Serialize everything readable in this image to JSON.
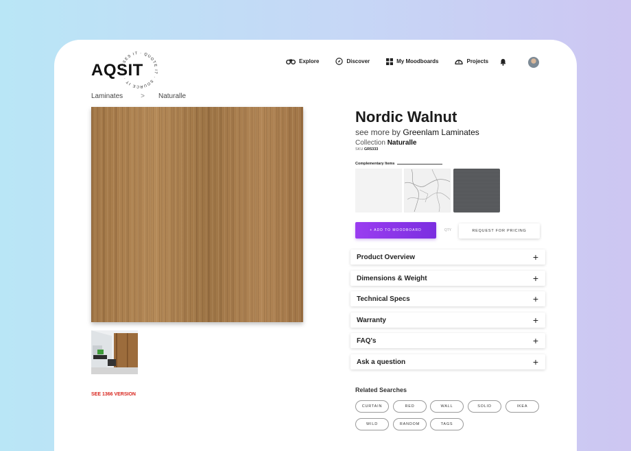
{
  "brand": {
    "logo_text": "AQSIT",
    "ring_text": "ASSES IT · QUOTE IT · SOURCE IT ·"
  },
  "nav": {
    "items": [
      {
        "label": "Explore",
        "icon": "binoculars-icon"
      },
      {
        "label": "Discover",
        "icon": "compass-icon"
      },
      {
        "label": "My Moodboards",
        "icon": "grid-icon"
      },
      {
        "label": "Projects",
        "icon": "helmet-icon"
      }
    ],
    "bell_icon": "bell-icon",
    "avatar_icon": "user-avatar"
  },
  "breadcrumb": {
    "items": [
      "Laminates",
      "Naturalle"
    ],
    "separator": ">"
  },
  "product": {
    "title": "Nordic Walnut",
    "by_prefix": "see more by ",
    "brand": "Greenlam Laminates",
    "collection_prefix": "Collection ",
    "collection": "Naturalle",
    "sku_prefix": "SKU ",
    "sku": "GR5333"
  },
  "complementary": {
    "title": "Complementary Items"
  },
  "actions": {
    "add_label": "+ ADD TO MOODBOARD",
    "qty_placeholder": "QTY",
    "pricing_label": "REQUEST FOR PRICING"
  },
  "accordion": [
    {
      "label": "Product Overview"
    },
    {
      "label": "Dimensions & Weight"
    },
    {
      "label": "Technical Specs"
    },
    {
      "label": "Warranty"
    },
    {
      "label": "FAQ's"
    },
    {
      "label": "Ask a question"
    }
  ],
  "accordion_plus": "+",
  "related": {
    "title": "Related Searches",
    "tags": [
      "CURTAIN",
      "RED",
      "WALL",
      "SOLID",
      "IKEA",
      "WILD",
      "RANDOM",
      "TAGS"
    ]
  },
  "see_version": "SEE 1366 VERSION",
  "colors": {
    "accent_purple": "#8a35ea",
    "link_red": "#d8241c"
  }
}
